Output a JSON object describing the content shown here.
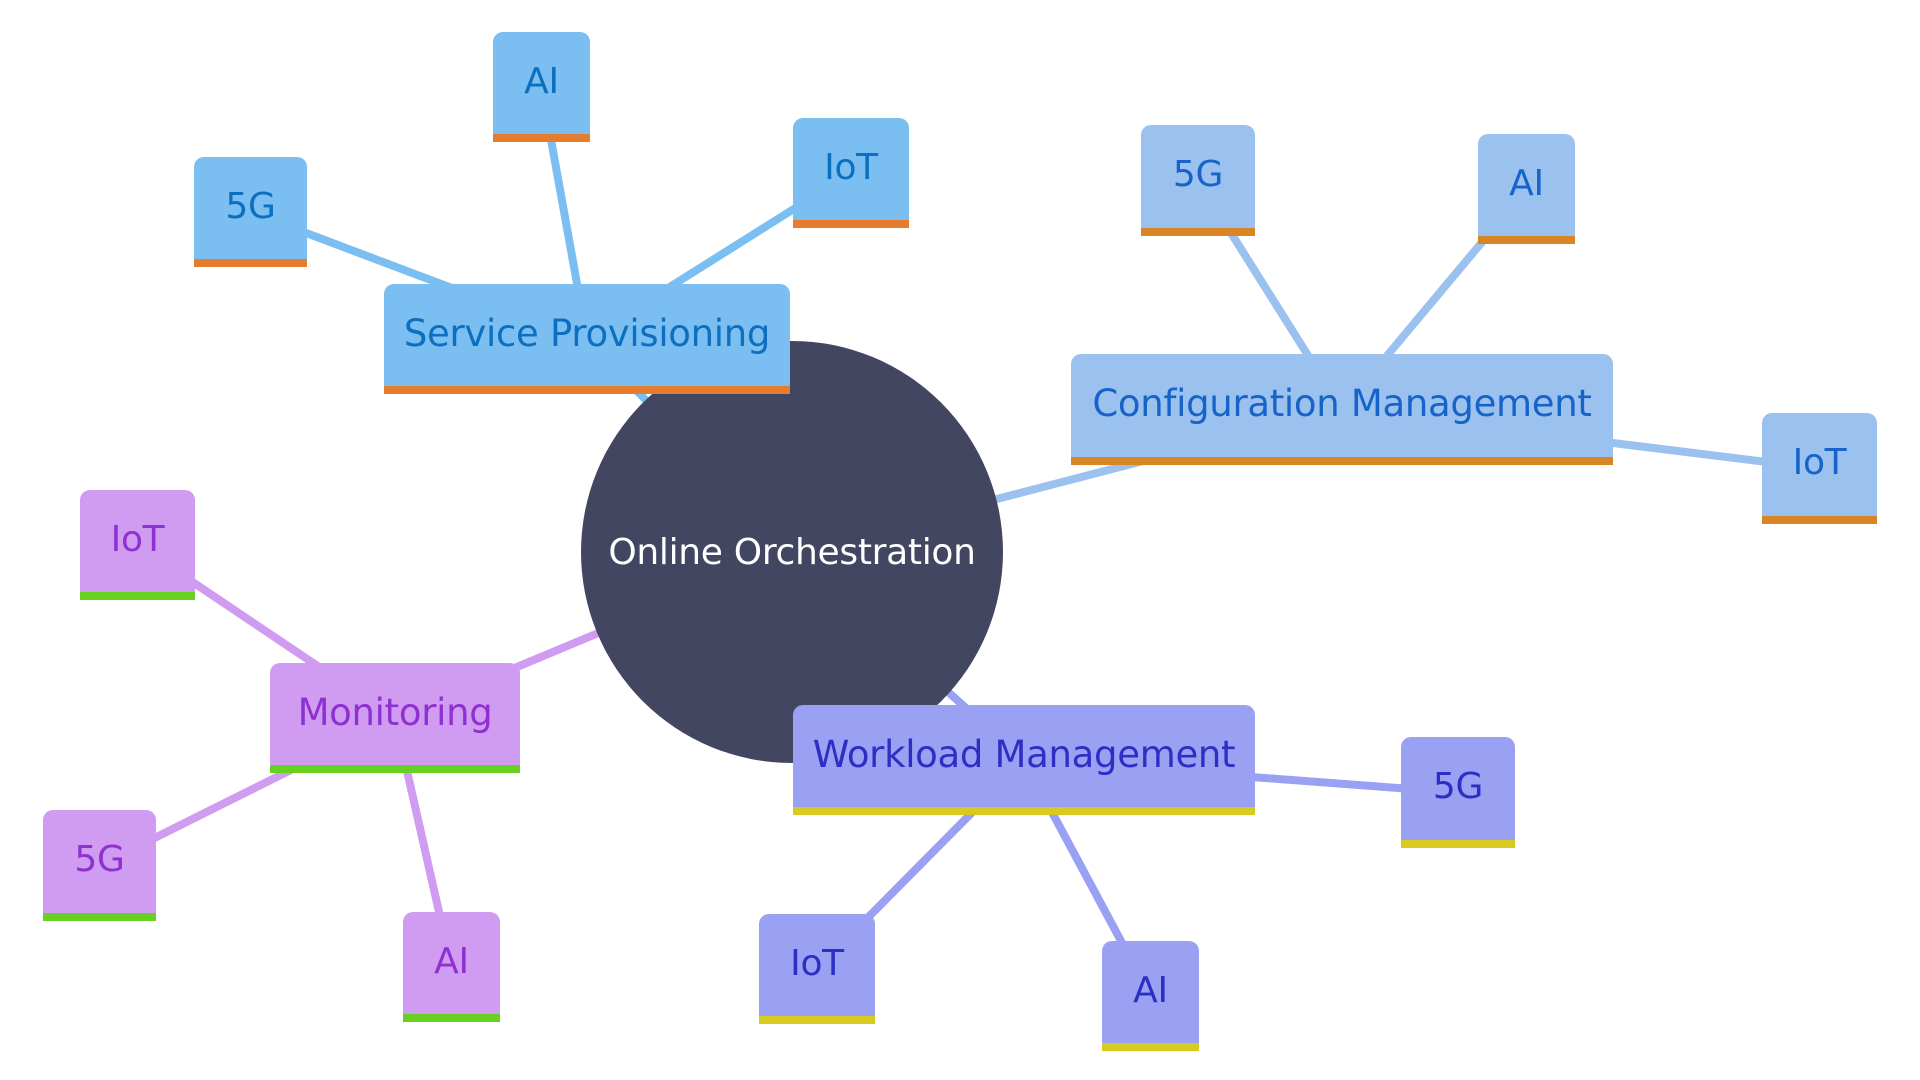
{
  "root": {
    "label": "Online Orchestration",
    "color": "#424660",
    "text_color": "#ffffff"
  },
  "branches": [
    {
      "id": "service-provisioning",
      "label": "Service Provisioning",
      "fill": "#7bbff2",
      "text_color": "#0c6fbf",
      "underline": "#e67c2e",
      "children": [
        {
          "label": "5G"
        },
        {
          "label": "AI"
        },
        {
          "label": "IoT"
        }
      ]
    },
    {
      "id": "configuration-management",
      "label": "Configuration Management",
      "fill": "#9bc2ef",
      "text_color": "#1763c9",
      "underline": "#d88526",
      "children": [
        {
          "label": "5G"
        },
        {
          "label": "AI"
        },
        {
          "label": "IoT"
        }
      ]
    },
    {
      "id": "monitoring",
      "label": "Monitoring",
      "fill": "#cf9cf1",
      "text_color": "#8f30d0",
      "underline": "#68d021",
      "children": [
        {
          "label": "IoT"
        },
        {
          "label": "5G"
        },
        {
          "label": "AI"
        }
      ]
    },
    {
      "id": "workload-management",
      "label": "Workload Management",
      "fill": "#9aa0f2",
      "text_color": "#2c2fc4",
      "underline": "#d6cb1e",
      "children": [
        {
          "label": "5G"
        },
        {
          "label": "IoT"
        },
        {
          "label": "AI"
        }
      ]
    }
  ]
}
